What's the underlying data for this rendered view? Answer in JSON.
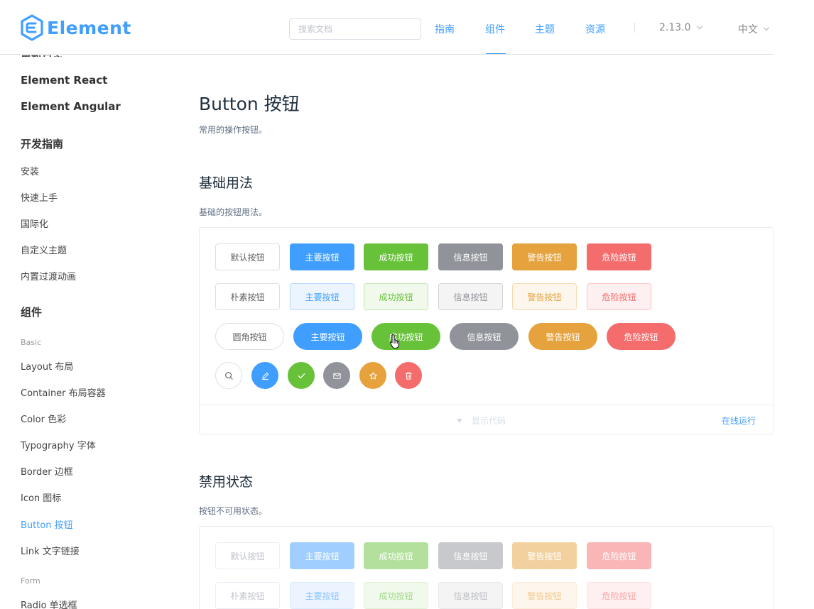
{
  "header": {
    "logo_text": "Element",
    "search_placeholder": "搜索文档",
    "nav": [
      "指南",
      "组件",
      "主题",
      "资源"
    ],
    "active_nav": "组件",
    "version": "2.13.0",
    "language": "中文"
  },
  "sidebar": {
    "clipped_top": "更新日志",
    "links": [
      "Element React",
      "Element Angular"
    ],
    "dev_guide_title": "开发指南",
    "dev_guide_items": [
      "安装",
      "快速上手",
      "国际化",
      "自定义主题",
      "内置过渡动画"
    ],
    "components_title": "组件",
    "basic_group": "Basic",
    "basic_items": [
      "Layout 布局",
      "Container 布局容器",
      "Color 色彩",
      "Typography 字体",
      "Border 边框",
      "Icon 图标",
      "Button 按钮",
      "Link 文字链接"
    ],
    "active_item": "Button 按钮",
    "form_group": "Form",
    "form_items": [
      "Radio 单选框"
    ]
  },
  "main": {
    "title": "Button 按钮",
    "description": "常用的操作按钮。",
    "basic": {
      "title": "基础用法",
      "description": "基础的按钮用法。",
      "row_default": [
        "默认按钮",
        "主要按钮",
        "成功按钮",
        "信息按钮",
        "警告按钮",
        "危险按钮"
      ],
      "row_plain": [
        "朴素按钮",
        "主要按钮",
        "成功按钮",
        "信息按钮",
        "警告按钮",
        "危险按钮"
      ],
      "row_round": [
        "圆角按钮",
        "主要按钮",
        "成功按钮",
        "信息按钮",
        "警告按钮",
        "危险按钮"
      ],
      "row_circle_icons": [
        "search-icon",
        "edit-icon",
        "check-icon",
        "message-icon",
        "star-icon",
        "delete-icon"
      ],
      "show_code": "显示代码",
      "run_online": "在线运行"
    },
    "disabled": {
      "title": "禁用状态",
      "description": "按钮不可用状态。",
      "row_default": [
        "默认按钮",
        "主要按钮",
        "成功按钮",
        "信息按钮",
        "警告按钮",
        "危险按钮"
      ],
      "row_plain": [
        "朴素按钮",
        "主要按钮",
        "成功按钮",
        "信息按钮",
        "警告按钮",
        "危险按钮"
      ]
    }
  },
  "colors": {
    "primary": "#409eff",
    "success": "#67c23a",
    "info": "#909399",
    "warning": "#e6a23c",
    "danger": "#f56c6c"
  }
}
